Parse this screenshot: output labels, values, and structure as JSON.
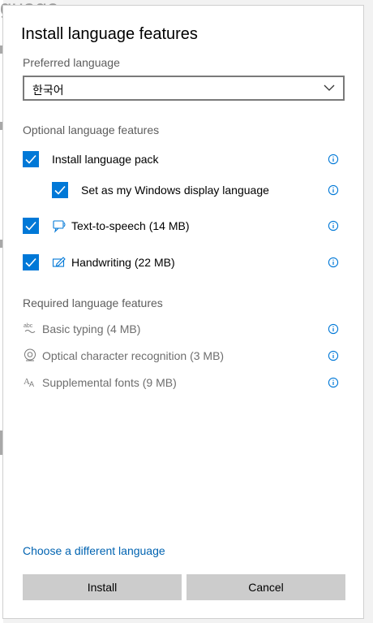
{
  "background": {
    "title_fragment": "guage"
  },
  "dialog": {
    "title": "Install language features",
    "preferred_label": "Preferred language",
    "preferred_value": "한국어",
    "optional_label": "Optional language features",
    "optional_items": [
      {
        "label": "Install language pack",
        "checked": true,
        "icon": "none"
      },
      {
        "label": "Set as my Windows display language",
        "checked": true,
        "icon": "none"
      },
      {
        "label": "Text-to-speech (14 MB)",
        "checked": true,
        "icon": "speech-icon"
      },
      {
        "label": "Handwriting (22 MB)",
        "checked": true,
        "icon": "pen-icon"
      }
    ],
    "required_label": "Required language features",
    "required_items": [
      {
        "label": "Basic typing (4 MB)",
        "icon": "abc-icon"
      },
      {
        "label": "Optical character recognition (3 MB)",
        "icon": "ocr-icon"
      },
      {
        "label": "Supplemental fonts (9 MB)",
        "icon": "fonts-icon"
      }
    ],
    "link": "Choose a different language",
    "install_label": "Install",
    "cancel_label": "Cancel"
  },
  "colors": {
    "accent": "#0078d7",
    "link": "#0063b1",
    "button": "#cccccc"
  }
}
